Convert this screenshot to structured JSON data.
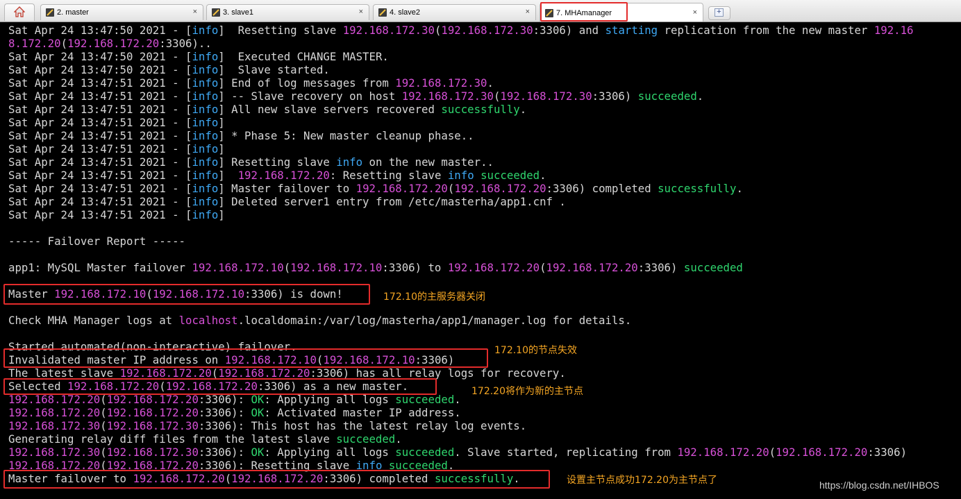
{
  "tabs": [
    {
      "label": "2. master",
      "close": "×"
    },
    {
      "label": "3. slave1",
      "close": "×"
    },
    {
      "label": "4. slave2",
      "close": "×"
    },
    {
      "label": "7. MHAmanager",
      "close": "×"
    }
  ],
  "new_tab_label": "+",
  "log": {
    "prefix": "Sat Apr 24 13:47:5",
    "l1": {
      "time": "0",
      "text_a": "  Resetting slave ",
      "ip1": "192.168.172.30",
      "ip2": "192.168.172.30",
      "port": ":3306) and ",
      "kw": "starting",
      "text_b": " replication from the new master ",
      "ip3": "192.16"
    },
    "l2": {
      "ip1": "8.172.20",
      "ip2": "192.168.172.20",
      "rest": ":3306).."
    },
    "l3": {
      "time": "0",
      "text": "  Executed CHANGE MASTER."
    },
    "l4": {
      "time": "0",
      "text": "  Slave started."
    },
    "l5": {
      "time": "1",
      "text": " End of log messages from ",
      "ip": "192.168.172.30",
      "end": "."
    },
    "l6": {
      "time": "1",
      "text": " -- Slave recovery on host ",
      "ip1": "192.168.172.30",
      "ip2": "192.168.172.30",
      "port": ":3306) ",
      "ok": "succeeded",
      "end": "."
    },
    "l7": {
      "time": "1",
      "text": " All new slave servers recovered ",
      "ok": "successfully",
      "end": "."
    },
    "l8": {
      "time": "1"
    },
    "l9": {
      "time": "1",
      "text": " * Phase 5: New master cleanup phase.."
    },
    "l10": {
      "time": "1"
    },
    "l11": {
      "time": "1",
      "text": " Resetting slave ",
      "kw": "info",
      "end": " on the new master.."
    },
    "l12": {
      "time": "1",
      "ip": "192.168.172.20",
      "text": ": Resetting slave ",
      "kw": "info",
      "ok": "succeeded",
      "end": "."
    },
    "l13": {
      "time": "1",
      "text": " Master failover to ",
      "ip1": "192.168.172.20",
      "ip2": "192.168.172.20",
      "port": ":3306) completed ",
      "ok": "successfully",
      "end": "."
    },
    "l14": {
      "time": "1",
      "text": " Deleted server1 entry from /etc/masterha/app1.cnf ."
    },
    "l15": {
      "time": "1"
    },
    "dash": "2021 - [",
    "info": "info",
    "close": "]",
    "report": "----- Failover Report -----",
    "app": {
      "text": "app1: MySQL Master failover ",
      "ip1": "192.168.172.10",
      "ip2": "192.168.172.10",
      "mid": ":3306) to ",
      "ip3": "192.168.172.20",
      "ip4": "192.168.172.20",
      "port": ":3306) ",
      "ok": "succeeded"
    },
    "down": {
      "text": "Master ",
      "ip1": "192.168.172.10",
      "ip2": "192.168.172.10",
      "end": ":3306) is down!"
    },
    "check": {
      "text": "Check MHA Manager logs at ",
      "host": "localhost",
      "end": ".localdomain:/var/log/masterha/app1/manager.log for details."
    },
    "started": "Started automated(non-interactive) failover.",
    "invalid": {
      "text": "Invalidated master IP address on ",
      "ip1": "192.168.172.10",
      "ip2": "192.168.172.10",
      "end": ":3306)"
    },
    "latest": {
      "text": "The latest slave ",
      "ip1": "192.168.172.20",
      "ip2": "192.168.172.20",
      "end": ":3306) has all relay logs for recovery."
    },
    "selected": {
      "text": "Selected ",
      "ip1": "192.168.172.20",
      "ip2": "192.168.172.20",
      "end": ":3306) as a new master."
    },
    "r1": {
      "ip1": "192.168.172.20",
      "ip2": "192.168.172.20",
      "port": ":3306): ",
      "ok1": "OK",
      "text": ": Applying all logs ",
      "ok2": "succeeded",
      "end": "."
    },
    "r2": {
      "ip1": "192.168.172.20",
      "ip2": "192.168.172.20",
      "port": ":3306): ",
      "ok1": "OK",
      "text": ": Activated master IP address."
    },
    "r3": {
      "ip1": "192.168.172.30",
      "ip2": "192.168.172.30",
      "port": ":3306): This host has the latest relay log events."
    },
    "r4": {
      "text": "Generating relay diff files from the latest slave ",
      "ok": "succeeded",
      "end": "."
    },
    "r5": {
      "ip1": "192.168.172.30",
      "ip2": "192.168.172.30",
      "port": ":3306): ",
      "ok1": "OK",
      "text": ": Applying all logs ",
      "ok2": "succeeded",
      "mid": ". Slave started, replicating from ",
      "ip3": "192.168.172.20",
      "ip4": "192.168.172.20",
      "end": ":3306)"
    },
    "r6": {
      "ip1": "192.168.172.20",
      "ip2": "192.168.172.20",
      "port": ":3306): Resetting slave ",
      "kw": "info",
      "ok": "succeeded",
      "end": "."
    },
    "final": {
      "text": "Master failover to ",
      "ip1": "192.168.172.20",
      "ip2": "192.168.172.20",
      "port": ":3306) completed ",
      "ok": "successfully",
      "end": "."
    }
  },
  "annotations": {
    "down": "172.10的主服务器关闭",
    "invalid": "172.10的节点失效",
    "selected": "172.20将作为新的主节点",
    "final": "设置主节点成功172.20为主节点了"
  },
  "watermark": "https://blog.csdn.net/IHBOS",
  "colors": {
    "ip": "#d650d6",
    "info": "#3fa9f5",
    "ok": "#2fd66e",
    "annotation": "#f5a623",
    "highlight_box": "#e32b2b"
  }
}
